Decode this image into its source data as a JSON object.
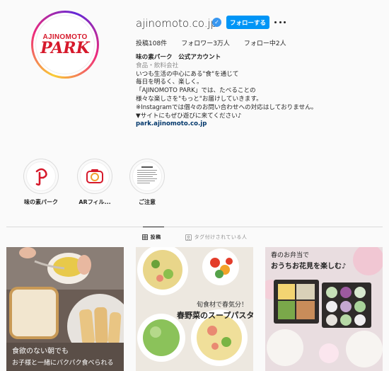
{
  "profile": {
    "username": "ajinomoto.co.jp",
    "logo_top": "AJINOMOTO",
    "logo_bottom": "PARK",
    "follow_label": "フォローする",
    "stats": {
      "posts": "投稿108件",
      "followers": "フォロワー3万人",
      "following": "フォロー中2人"
    },
    "bio": {
      "name": "味の素パーク　公式アカウント",
      "category": "食品・飲料会社",
      "lines": [
        "いつも生活の中心にある\"食\"を通じて",
        "毎日を明るく、楽しく。",
        "「AJINOMOTO PARK」では、たべることの",
        "様々な楽しさを\"もっと\"お届けしていきます。",
        "※Instagramでは個々のお問い合わせへの対応はしておりません。",
        "▼サイトにもぜひ遊びに来てください♪"
      ],
      "link": "park.ajinomoto.co.jp"
    }
  },
  "highlights": [
    {
      "label": "味の素パーク"
    },
    {
      "label": "ARフィル..."
    },
    {
      "label": "ご注意"
    }
  ],
  "tabs": [
    {
      "label": "投稿"
    },
    {
      "label": "タグ付けされている人"
    }
  ],
  "posts": [
    {
      "caption_line1": "食欲のない朝でも",
      "caption_line2": "お子様と一緒にパクパク食べられる"
    },
    {
      "caption_line1": "旬食材で春気分！",
      "caption_line2": "春野菜のスープパスタ"
    },
    {
      "caption_line1": "春のお弁当で",
      "caption_line2": "おうちお花見を楽しむ♪"
    }
  ],
  "colors": {
    "brand_red": "#d6192b",
    "follow_blue": "#0095f6",
    "verified_blue": "#3897f0"
  }
}
